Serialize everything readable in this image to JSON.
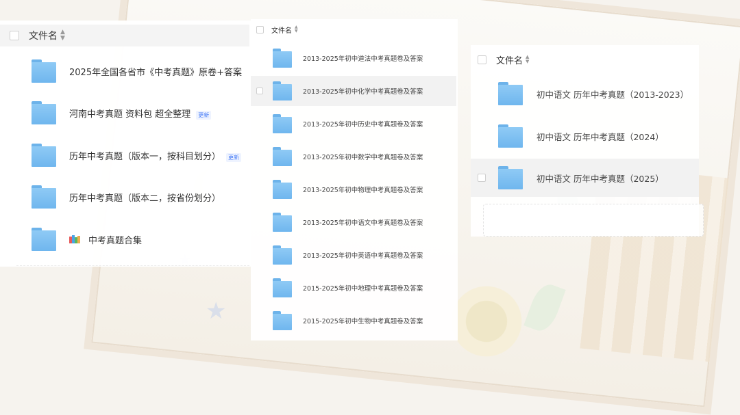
{
  "panel_left": {
    "header_label": "文件名",
    "sort_icon": "sort-arrows-icon",
    "items": [
      {
        "name": "2025年全国各省市《中考真题》原卷+答案",
        "badge": ""
      },
      {
        "name": "河南中考真题 资料包  超全整理",
        "badge": "更新"
      },
      {
        "name": "历年中考真题（版本一，按科目划分）",
        "badge": "更新"
      },
      {
        "name": "历年中考真题（版本二，按省份划分）",
        "badge": ""
      },
      {
        "name": "中考真题合集",
        "badge": "",
        "icon": "books-icon"
      }
    ]
  },
  "panel_middle": {
    "header_label": "文件名",
    "items": [
      "2013-2025年初中道法中考真题卷及答案",
      "2013-2025年初中化学中考真题卷及答案",
      "2013-2025年初中历史中考真题卷及答案",
      "2013-2025年初中数学中考真题卷及答案",
      "2013-2025年初中物理中考真题卷及答案",
      "2013-2025年初中语文中考真题卷及答案",
      "2013-2025年初中英语中考真题卷及答案",
      "2015-2025年初中地理中考真题卷及答案",
      "2015-2025年初中生物中考真题卷及答案"
    ],
    "highlighted_index": 1
  },
  "panel_right": {
    "header_label": "文件名",
    "items": [
      "初中语文 历年中考真题（2013-2023）",
      "初中语文 历年中考真题（2024）",
      "初中语文 历年中考真题（2025）"
    ],
    "highlighted_index": 2
  },
  "colors": {
    "folder": "#7bbcf0",
    "badge_text": "#4a7ef6",
    "row_highlight": "#f2f2f2"
  }
}
